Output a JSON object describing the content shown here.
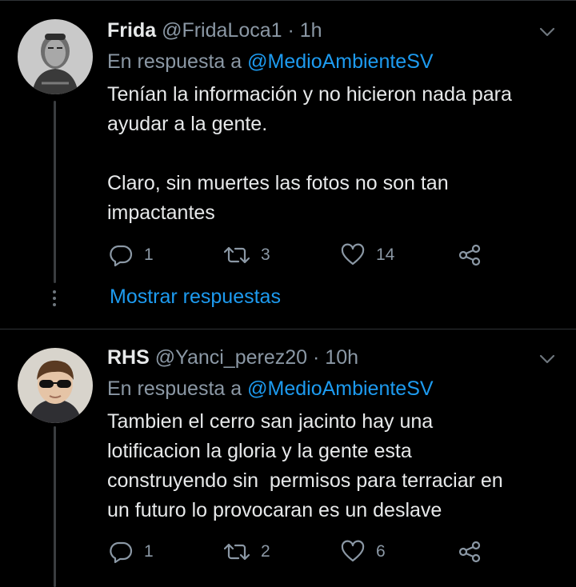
{
  "colors": {
    "background": "#000000",
    "text": "#e7e9ea",
    "secondary": "#8b98a5",
    "link": "#1d9bf0",
    "divider": "#2f3336"
  },
  "tweets": [
    {
      "name": "Frida",
      "handle": "@FridaLoca1",
      "separator": "·",
      "time": "1h",
      "reply_prefix": "En respuesta a",
      "reply_mention": "@MedioAmbienteSV",
      "lines": [
        "Tenían la información y no hicieron nada para",
        "ayudar a la gente.",
        "",
        "Claro, sin muertes las fotos no son tan",
        "impactantes"
      ],
      "replies": "1",
      "retweets": "3",
      "likes": "14",
      "icons": {
        "more": "chevron-down-icon",
        "reply": "reply-icon",
        "retweet": "retweet-icon",
        "like": "heart-icon",
        "share": "share-icon"
      }
    },
    {
      "name": "RHS",
      "handle": "@Yanci_perez20",
      "separator": "·",
      "time": "10h",
      "reply_prefix": "En respuesta a",
      "reply_mention": "@MedioAmbienteSV",
      "lines": [
        "Tambien el cerro san jacinto hay una",
        "lotificacion la gloria y la gente esta",
        "construyendo sin  permisos para terraciar en",
        "un futuro lo provocaran es un deslave"
      ],
      "replies": "1",
      "retweets": "2",
      "likes": "6",
      "icons": {
        "more": "chevron-down-icon",
        "reply": "reply-icon",
        "retweet": "retweet-icon",
        "like": "heart-icon",
        "share": "share-icon"
      }
    }
  ],
  "show_replies_label": "Mostrar respuestas"
}
